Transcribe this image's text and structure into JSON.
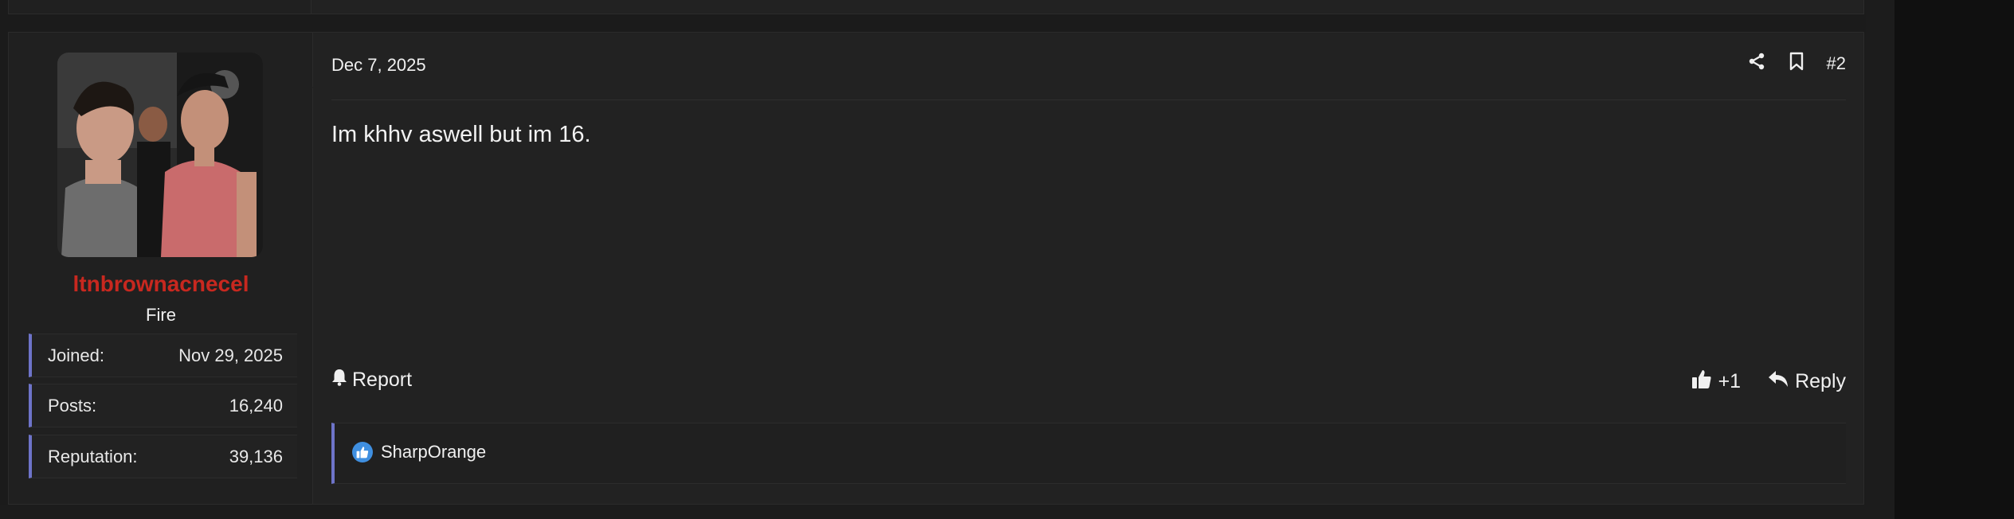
{
  "post": {
    "date": "Dec 7, 2025",
    "number": "#2",
    "body": "Im khhv aswell but im 16.",
    "report_label": "Report",
    "like_count": "+1",
    "reply_label": "Reply",
    "reactions": {
      "user": "SharpOrange"
    }
  },
  "user": {
    "username": "ltnbrownacnecel",
    "title": "Fire",
    "stats": [
      {
        "label": "Joined:",
        "value": "Nov 29, 2025"
      },
      {
        "label": "Posts:",
        "value": "16,240"
      },
      {
        "label": "Reputation:",
        "value": "39,136"
      }
    ]
  },
  "colors": {
    "username": "#c8281f",
    "accent": "#6e74c9",
    "like": "#3f8fe0"
  },
  "icons": [
    "share-icon",
    "bookmark-icon",
    "bell-icon",
    "thumbs-up-icon",
    "reply-icon",
    "like-reaction-icon"
  ]
}
